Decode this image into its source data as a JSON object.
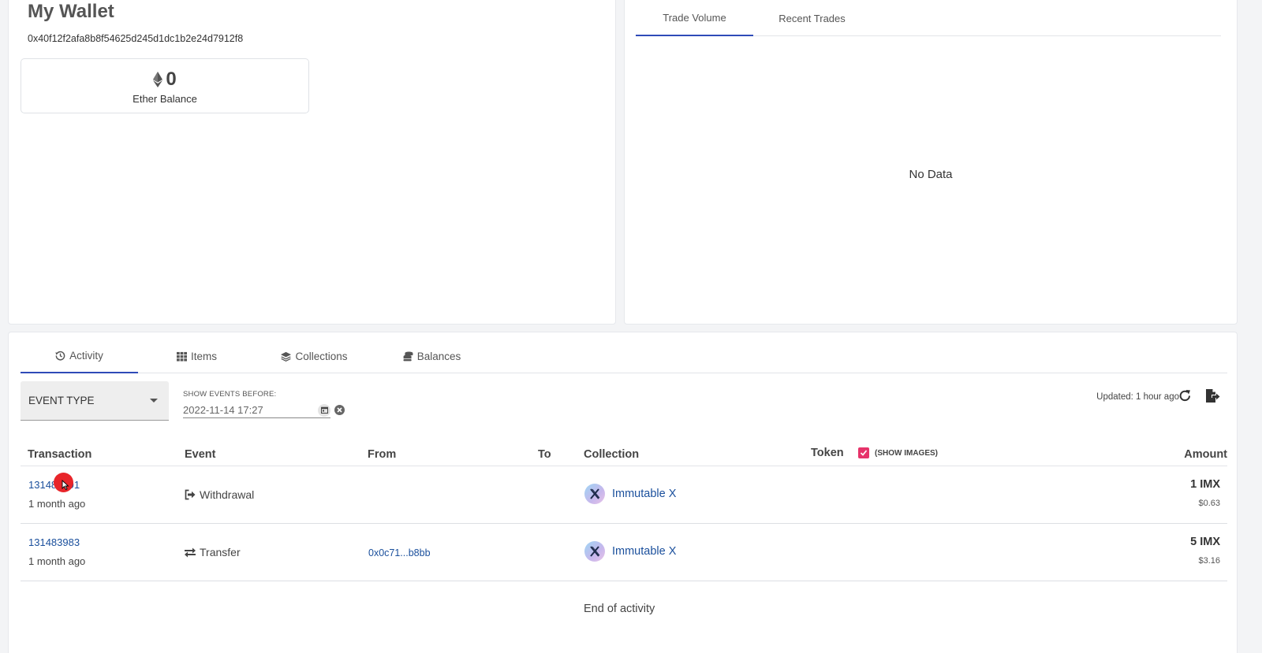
{
  "wallet": {
    "title": "My Wallet",
    "address": "0x40f12f2afa8b8f54625d245d1dc1b2e24d7912f8",
    "balance_value": "0",
    "balance_label": "Ether Balance"
  },
  "chart_panel": {
    "tabs": [
      "Trade Volume",
      "Recent Trades"
    ],
    "active_tab": "Trade Volume",
    "empty_text": "No Data"
  },
  "activity": {
    "tabs": [
      {
        "label": "Activity",
        "icon": "history-icon"
      },
      {
        "label": "Items",
        "icon": "grid-icon"
      },
      {
        "label": "Collections",
        "icon": "layers-icon"
      },
      {
        "label": "Balances",
        "icon": "coins-icon"
      }
    ],
    "active_tab": "Activity",
    "filters": {
      "event_type_label": "EVENT TYPE",
      "date_label": "SHOW EVENTS BEFORE:",
      "date_value": "2022-11-14 17:27"
    },
    "updated_text": "Updated: 1 hour ago",
    "table": {
      "headers": {
        "transaction": "Transaction",
        "event": "Event",
        "from": "From",
        "to": "To",
        "collection": "Collection",
        "token": "Token",
        "show_images": "(SHOW IMAGES)",
        "amount": "Amount"
      },
      "show_images_checked": true,
      "rows": [
        {
          "transaction": "131483991",
          "time": "1 month ago",
          "event": "Withdrawal",
          "event_icon": "sign-out-icon",
          "from": "",
          "to": "",
          "collection": "Immutable X",
          "amount": "1 IMX",
          "amount_usd": "$0.63"
        },
        {
          "transaction": "131483983",
          "time": "1 month ago",
          "event": "Transfer",
          "event_icon": "exchange-icon",
          "from": "0x0c71...b8bb",
          "to": "",
          "collection": "Immutable X",
          "amount": "5 IMX",
          "amount_usd": "$3.16"
        }
      ]
    },
    "end_text": "End of activity"
  },
  "colors": {
    "accent_blue": "#2f4bb8",
    "link_blue": "#1a4f9c",
    "checkbox_pink": "#e6336a",
    "cursor_red": "#e8252a"
  }
}
